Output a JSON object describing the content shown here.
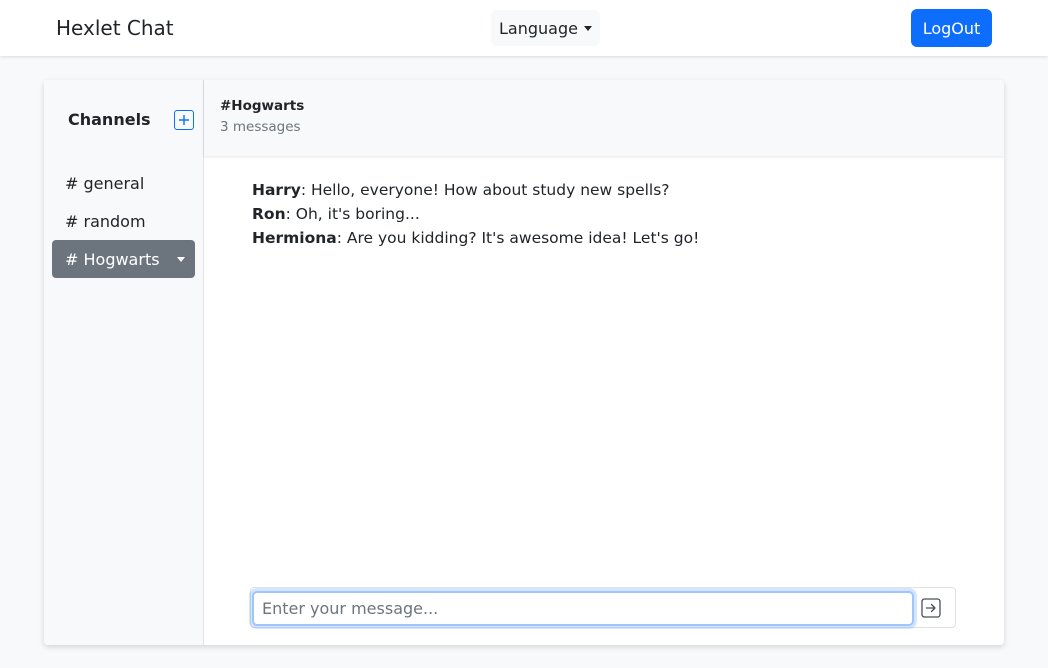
{
  "navbar": {
    "brand": "Hexlet Chat",
    "language_label": "Language",
    "logout_label": "LogOut"
  },
  "sidebar": {
    "title": "Channels",
    "add_icon": "plus-square-icon",
    "channels": [
      {
        "label": "# general",
        "active": false
      },
      {
        "label": "# random",
        "active": false
      },
      {
        "label": "# Hogwarts",
        "active": true
      }
    ]
  },
  "chat": {
    "title": "#Hogwarts",
    "count": "3 messages",
    "messages": [
      {
        "author": "Harry",
        "text": ": Hello, everyone! How about study new spells?"
      },
      {
        "author": "Ron",
        "text": ": Oh, it's boring..."
      },
      {
        "author": "Hermiona",
        "text": ": Are you kidding? It's awesome idea! Let's go!"
      }
    ],
    "input_placeholder": "Enter your message...",
    "input_value": "",
    "send_icon": "arrow-right-square-icon"
  },
  "colors": {
    "primary": "#0d6efd",
    "active_channel": "#6c757d",
    "background": "#f8f9fa"
  }
}
